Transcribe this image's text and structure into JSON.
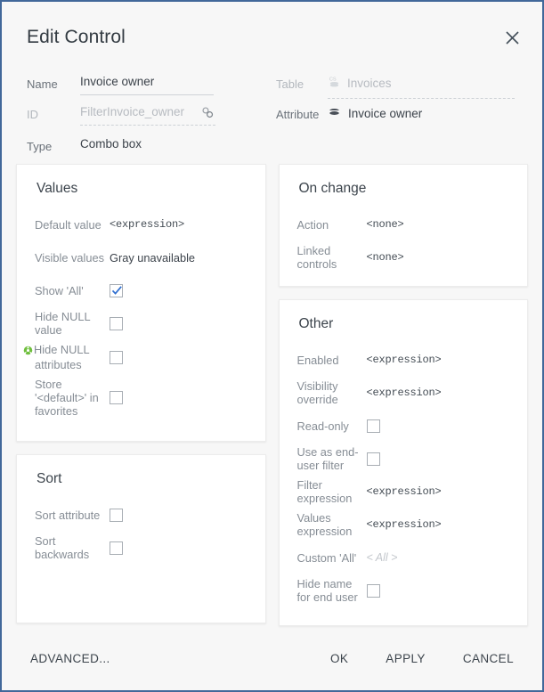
{
  "dialog": {
    "title": "Edit Control",
    "close_icon": "close-icon"
  },
  "form": {
    "name": {
      "label": "Name",
      "value": "Invoice owner"
    },
    "id": {
      "label": "ID",
      "placeholder": "FilterInvoice_owner",
      "link_icon": "chain-link-icon"
    },
    "type": {
      "label": "Type",
      "value": "Combo box"
    },
    "table": {
      "label": "Table",
      "value": "Invoices",
      "icon": "cube-cs-icon"
    },
    "attribute": {
      "label": "Attribute",
      "value": "Invoice owner",
      "icon": "attribute-disc-icon"
    }
  },
  "values_card": {
    "title": "Values",
    "rows": [
      {
        "label": "Default value",
        "value": "<expression>",
        "kind": "mono"
      },
      {
        "label": "Visible values",
        "value": "Gray unavailable",
        "kind": "text"
      },
      {
        "label": "Show 'All'",
        "checked": true,
        "kind": "checkbox"
      },
      {
        "label": "Hide NULL value",
        "checked": false,
        "kind": "checkbox"
      },
      {
        "label": "Hide NULL attributes",
        "checked": false,
        "kind": "checkbox",
        "icon": "green-warning-icon"
      },
      {
        "label": "Store '<default>' in favorites",
        "checked": false,
        "kind": "checkbox"
      }
    ]
  },
  "sort_card": {
    "title": "Sort",
    "rows": [
      {
        "label": "Sort attribute",
        "checked": false,
        "kind": "checkbox"
      },
      {
        "label": "Sort backwards",
        "checked": false,
        "kind": "checkbox"
      }
    ]
  },
  "onchange_card": {
    "title": "On change",
    "rows": [
      {
        "label": "Action",
        "value": "<none>",
        "kind": "mono"
      },
      {
        "label": "Linked controls",
        "value": "<none>",
        "kind": "mono"
      }
    ]
  },
  "other_card": {
    "title": "Other",
    "rows": [
      {
        "label": "Enabled",
        "value": "<expression>",
        "kind": "mono"
      },
      {
        "label": "Visibility override",
        "value": "<expression>",
        "kind": "mono"
      },
      {
        "label": "Read-only",
        "checked": false,
        "kind": "checkbox"
      },
      {
        "label": "Use as end-user filter",
        "checked": false,
        "kind": "checkbox"
      },
      {
        "label": "Filter expression",
        "value": "<expression>",
        "kind": "mono"
      },
      {
        "label": "Values expression",
        "value": "<expression>",
        "kind": "mono"
      },
      {
        "label": "Custom 'All'",
        "value": "< All >",
        "kind": "placeholder"
      },
      {
        "label": "Hide name for end user",
        "checked": false,
        "kind": "checkbox"
      }
    ]
  },
  "footer": {
    "advanced": "ADVANCED...",
    "ok": "OK",
    "apply": "APPLY",
    "cancel": "CANCEL"
  },
  "colors": {
    "window_border": "#41689a",
    "background": "#f7f7f7",
    "card": "#ffffff",
    "label": "#868d95",
    "value": "#3d444c",
    "check": "#2f6fd0"
  }
}
